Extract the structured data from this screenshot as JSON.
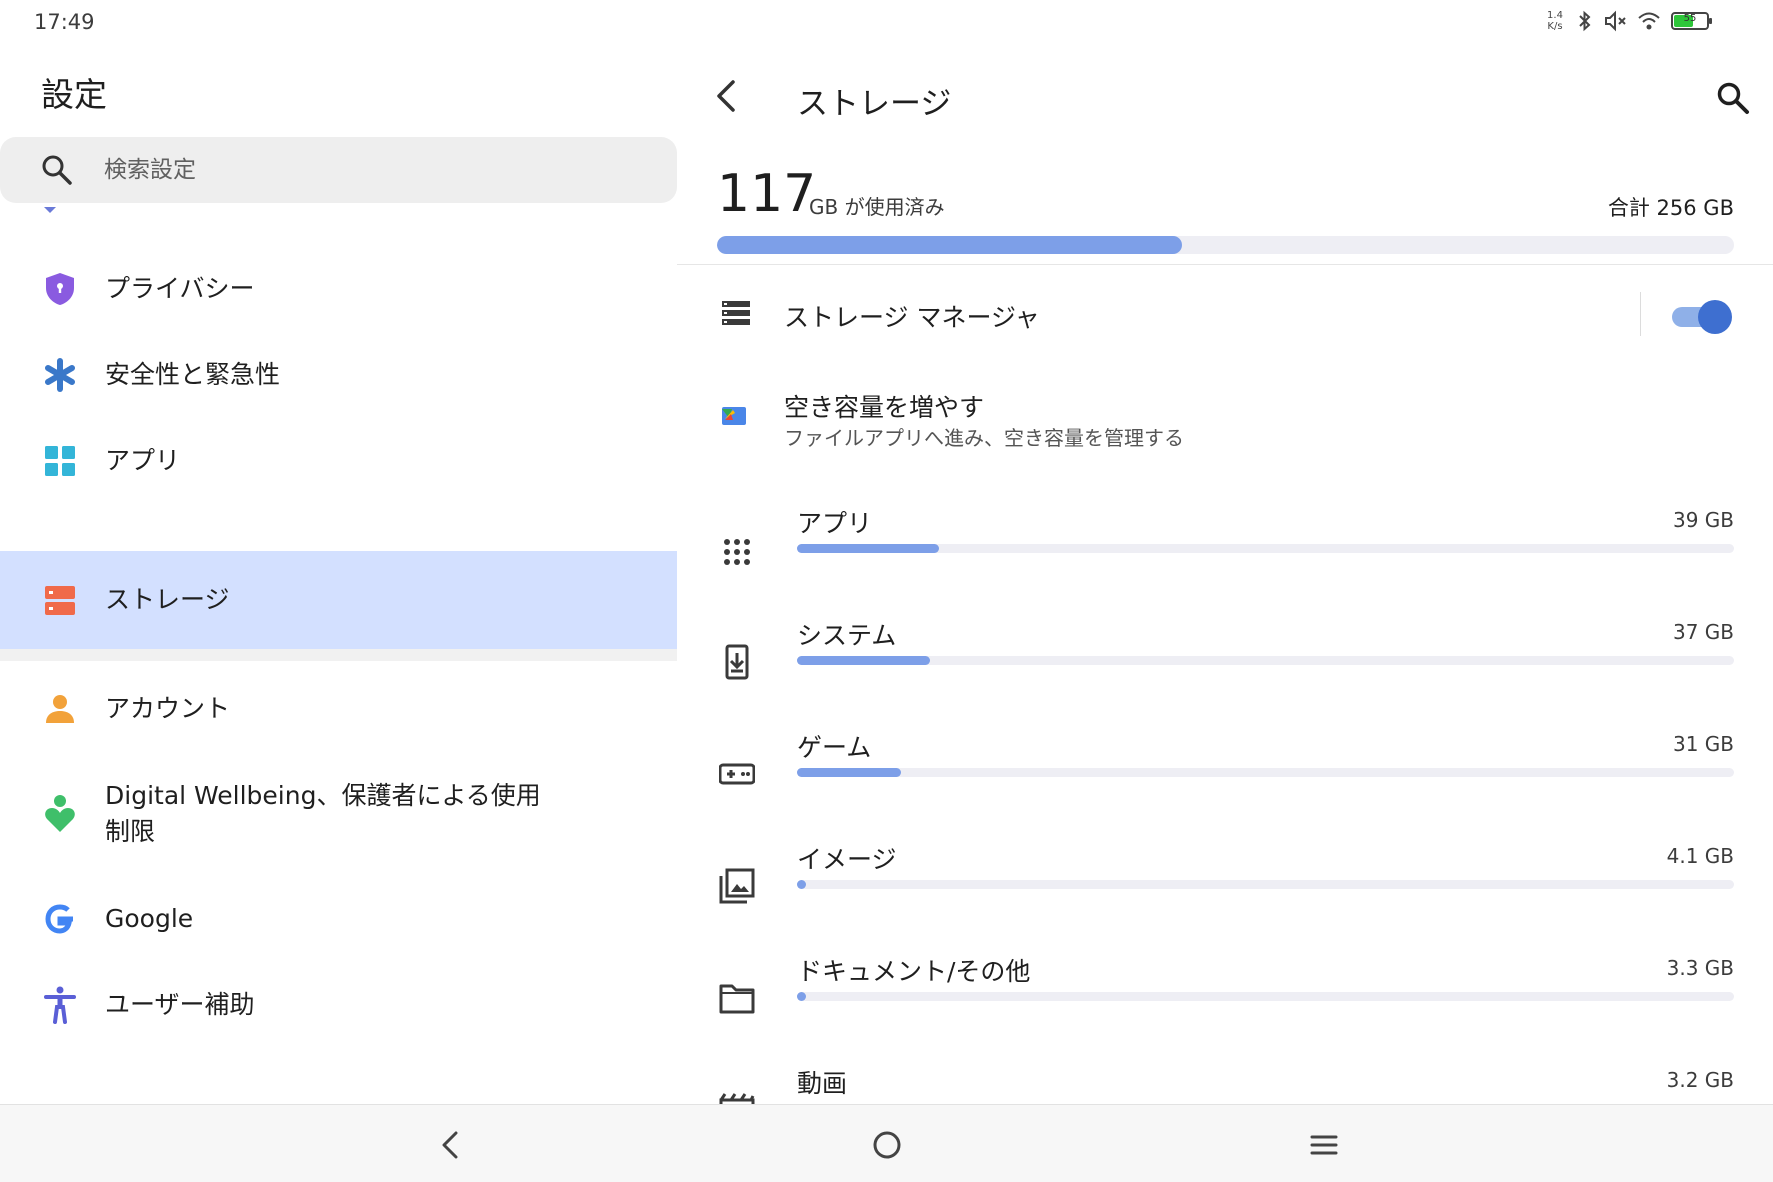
{
  "status_bar": {
    "time": "17:49",
    "net_speed_value": "1.4",
    "net_speed_unit": "K/s",
    "icons": [
      "bluetooth-icon",
      "mute-icon",
      "wifi-icon",
      "battery-icon"
    ],
    "battery_percent": 55,
    "battery_label": "55"
  },
  "settings": {
    "title": "設定",
    "search_placeholder": "検索設定",
    "items": [
      {
        "label": "プライバシー",
        "icon": "privacy-shield-icon",
        "color": "#8a5be0"
      },
      {
        "label": "安全性と緊急性",
        "icon": "asterisk-icon",
        "color": "#3a78c9"
      },
      {
        "label": "アプリ",
        "icon": "apps-grid-icon",
        "color": "#33b5d8"
      },
      {
        "label": "ストレージ",
        "icon": "storage-icon",
        "color": "#f06a4a"
      },
      {
        "label": "アカウント",
        "icon": "account-icon",
        "color": "#f2a23a"
      },
      {
        "label": "Digital Wellbeing、保護者による使用制限",
        "icon": "wellbeing-icon",
        "color": "#3fbf6a"
      },
      {
        "label": "Google",
        "icon": "google-icon",
        "color": "#4285f4"
      },
      {
        "label": "ユーザー補助",
        "icon": "accessibility-icon",
        "color": "#5a5fd6"
      }
    ],
    "selected_index": 3
  },
  "storage": {
    "title": "ストレージ",
    "used_value": "117",
    "used_unit": "GB が使用済み",
    "total": "合計 256 GB",
    "used_fraction": 0.457,
    "manager_label": "ストレージ マネージャ",
    "manager_enabled": true,
    "free_up_title": "空き容量を増やす",
    "free_up_subtitle": "ファイルアプリへ進み、空き容量を管理する",
    "categories": [
      {
        "label": "アプリ",
        "size": "39 GB",
        "fraction": 0.152,
        "icon": "apps-dots-icon"
      },
      {
        "label": "システム",
        "size": "37 GB",
        "fraction": 0.142,
        "icon": "system-download-icon"
      },
      {
        "label": "ゲーム",
        "size": "31 GB",
        "fraction": 0.111,
        "icon": "gamepad-icon"
      },
      {
        "label": "イメージ",
        "size": "4.1 GB",
        "fraction": 0.01,
        "icon": "image-icon"
      },
      {
        "label": "ドキュメント/その他",
        "size": "3.3 GB",
        "fraction": 0.01,
        "icon": "folder-icon"
      },
      {
        "label": "動画",
        "size": "3.2 GB",
        "fraction": 0.01,
        "icon": "video-icon"
      }
    ]
  },
  "colors": {
    "accent": "#7d9fe8",
    "selected_bg": "#d3e0ff",
    "toggle_on": "#3e6fd0"
  }
}
